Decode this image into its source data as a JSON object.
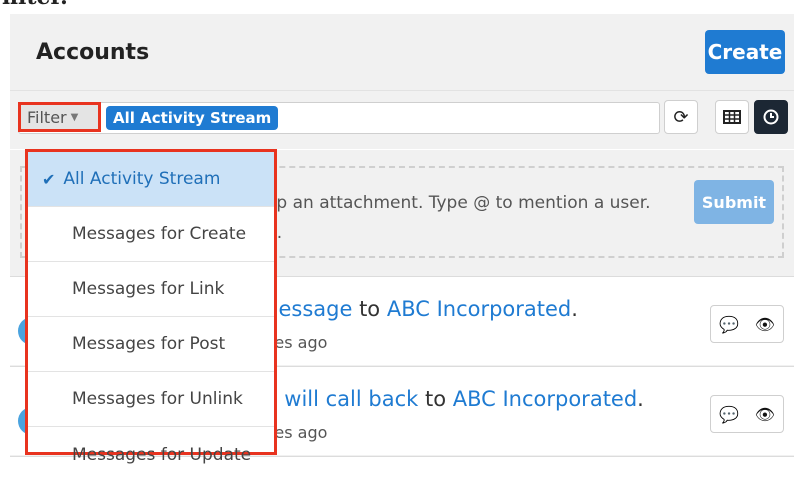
{
  "page_top_text": "filter.",
  "header": {
    "title": "Accounts",
    "create_label": "Create"
  },
  "toolbar": {
    "filter_label": "Filter",
    "active_filter": "All Activity Stream",
    "refresh_icon": "refresh-icon",
    "grid_icon": "grid-view-icon",
    "activity_icon": "clock-icon"
  },
  "composer": {
    "placeholder_visible": "op an attachment. Type @ to mention a user.",
    "placeholder_visible_2": "d.",
    "submit_label": "Submit"
  },
  "entries": [
    {
      "text_before": "message",
      "joiner": " to ",
      "target": "ABC Incorporated",
      "end": ".",
      "time": "utes ago"
    },
    {
      "text_before": "e, will call back",
      "joiner": " to ",
      "target": "ABC Incorporated",
      "end": ".",
      "time": "utes ago"
    }
  ],
  "dropdown": {
    "items": [
      {
        "label": "All Activity Stream",
        "selected": true
      },
      {
        "label": "Messages for Create",
        "selected": false
      },
      {
        "label": "Messages for Link",
        "selected": false
      },
      {
        "label": "Messages for Post",
        "selected": false
      },
      {
        "label": "Messages for Unlink",
        "selected": false
      },
      {
        "label": "Messages for Update",
        "selected": false
      }
    ]
  },
  "colors": {
    "accent": "#1f7bd2",
    "highlight_border": "#e8331f",
    "selected_bg": "#cbe2f7",
    "panel_bg": "#f1f1f1"
  }
}
